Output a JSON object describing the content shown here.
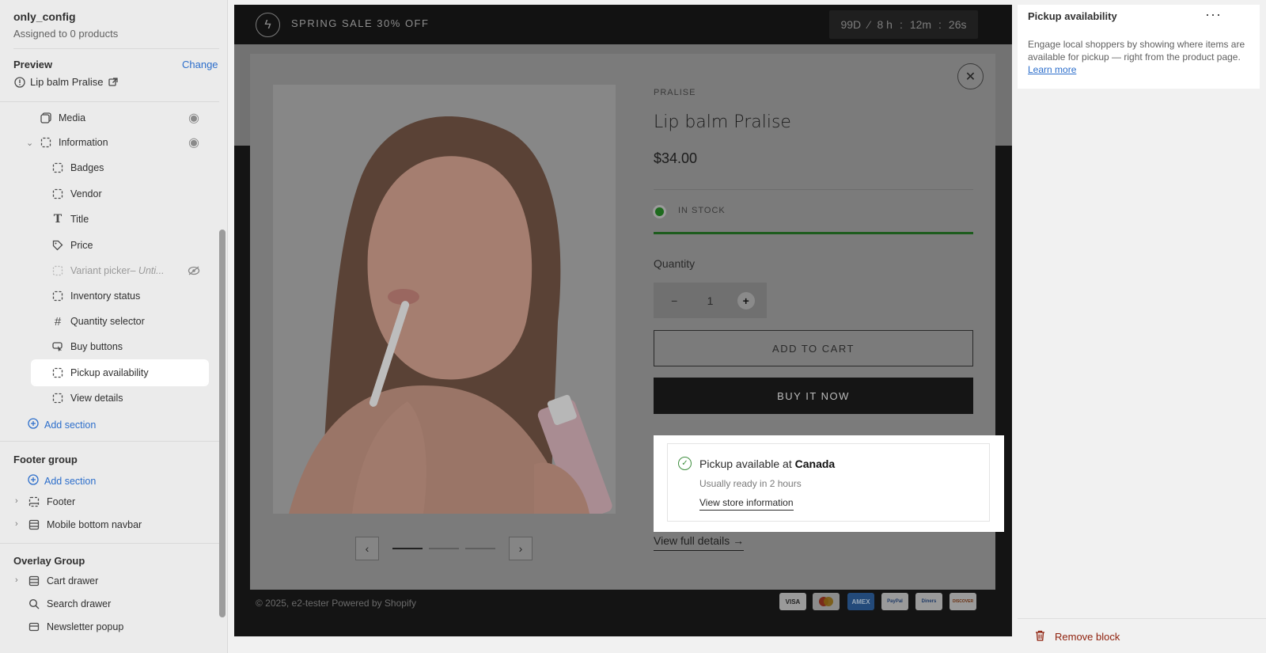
{
  "sidebar": {
    "template_name": "only_config",
    "template_sub": "Assigned to 0 products",
    "preview_heading": "Preview",
    "change_label": "Change",
    "preview_product": "Lip balm Pralise",
    "tree": {
      "media": "Media",
      "information": "Information",
      "badges": "Badges",
      "vendor": "Vendor",
      "title": "Title",
      "price": "Price",
      "variant_picker": "Variant picker",
      "variant_picker_suffix": " – Unti...",
      "inventory_status": "Inventory status",
      "quantity_selector": "Quantity selector",
      "buy_buttons": "Buy buttons",
      "pickup_availability": "Pickup availability",
      "view_details": "View details"
    },
    "add_section": "Add section",
    "footer_group": "Footer group",
    "footer": "Footer",
    "mobile_navbar": "Mobile bottom navbar",
    "overlay_group": "Overlay Group",
    "cart_drawer": "Cart drawer",
    "search_drawer": "Search drawer",
    "newsletter_popup": "Newsletter popup"
  },
  "store": {
    "announcement": "SPRING SALE 30% OFF",
    "countdown": {
      "days": "99D",
      "hours": "8 h",
      "minutes": "12m",
      "seconds": "26s",
      "sep": ":",
      "slash": "⁄"
    },
    "copyright": "© 2025, e2-tester Powered by Shopify",
    "payments": [
      "VISA",
      "MC",
      "AMEX",
      "PayPal",
      "Diners",
      "DISCOVER"
    ]
  },
  "product": {
    "vendor": "PRALISE",
    "title": "Lip balm Pralise",
    "price": "$34.00",
    "stock": "IN STOCK",
    "quantity_label": "Quantity",
    "quantity": "1",
    "add_to_cart": "ADD TO CART",
    "buy_now": "BUY IT NOW",
    "view_full": "View full details →"
  },
  "pickup": {
    "title_prefix": "Pickup available at ",
    "location": "Canada",
    "ready": "Usually ready in 2 hours",
    "link": "View store information"
  },
  "right_panel": {
    "title": "Pickup availability",
    "description": "Engage local shoppers by showing where items are available for pickup — right from the product page. ",
    "learn_more": "Learn more",
    "remove": "Remove block"
  },
  "colors": {
    "accent": "#2c6ecb",
    "danger": "#8e1f0b",
    "instock": "#1d5c1d"
  }
}
